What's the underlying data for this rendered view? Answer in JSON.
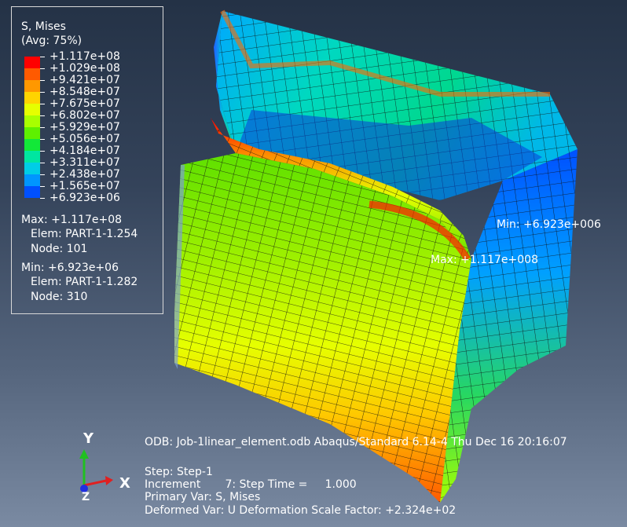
{
  "legend": {
    "title": "S, Mises",
    "subtitle": "(Avg: 75%)",
    "values": [
      "+1.117e+08",
      "+1.029e+08",
      "+9.421e+07",
      "+8.548e+07",
      "+7.675e+07",
      "+6.802e+07",
      "+5.929e+07",
      "+5.056e+07",
      "+4.184e+07",
      "+3.311e+07",
      "+2.438e+07",
      "+1.565e+07",
      "+6.923e+06"
    ],
    "colors": [
      "#ff0000",
      "#ff5a00",
      "#ff9800",
      "#ffd400",
      "#e6ff00",
      "#a8ff00",
      "#5ef000",
      "#12e838",
      "#00e6a0",
      "#00cde6",
      "#0096ff",
      "#0050ff",
      "#0018f0"
    ],
    "max_label": "Max: +1.117e+08",
    "max_elem": "Elem: PART-1-1.254",
    "max_node": "Node: 101",
    "min_label": "Min: +6.923e+06",
    "min_elem": "Elem: PART-1-1.282",
    "min_node": "Node: 310"
  },
  "annotations": {
    "min_marker": "Min: +6.923e+006",
    "max_marker": "Max: +1.117e+008"
  },
  "info": {
    "odb_line": "ODB: Job-1linear_element.odb    Abaqus/Standard 6.14-4    Thu Dec 16 20:16:07",
    "step": "Step: Step-1",
    "increment": "Increment       7: Step Time =     1.000",
    "primary_var": "Primary Var: S, Mises",
    "deformed_var": "Deformed Var: U   Deformation Scale Factor: +2.324e+02"
  },
  "triad": {
    "y": "Y",
    "x": "X",
    "z": "Z"
  }
}
